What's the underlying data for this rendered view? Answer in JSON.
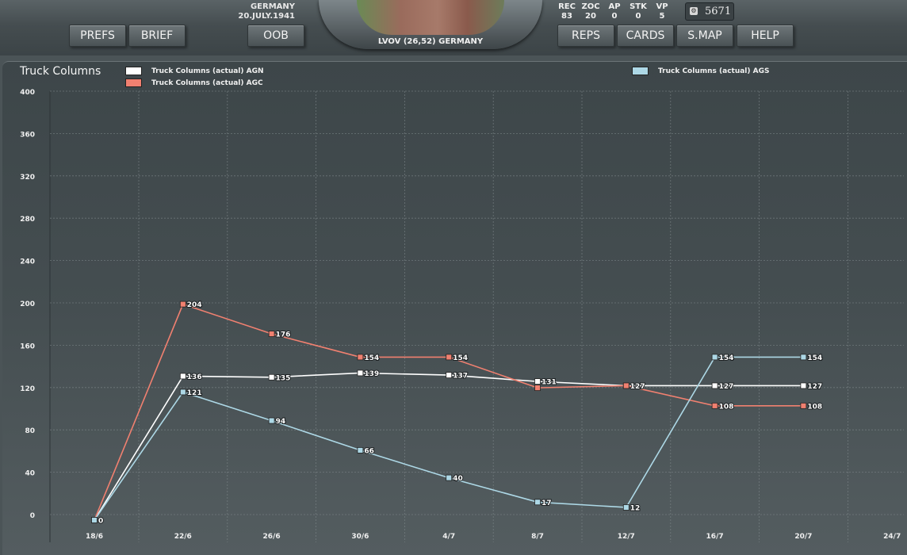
{
  "header": {
    "nation": "GERMANY",
    "date": "20.JULY.1941",
    "location": "LVOV (26,52) GERMANY",
    "prestige": "5671"
  },
  "buttons": {
    "prefs": "PREFS",
    "brief": "BRIEF",
    "oob": "OOB",
    "reps": "REPS",
    "cards": "CARDS",
    "smap": "S.MAP",
    "help": "HELP"
  },
  "stats": [
    {
      "label": "REC",
      "value": "83"
    },
    {
      "label": "ZOC",
      "value": "20"
    },
    {
      "label": "AP",
      "value": "0"
    },
    {
      "label": "STK",
      "value": "0"
    },
    {
      "label": "VP",
      "value": "5"
    }
  ],
  "colors": {
    "agn": "#ffffff",
    "agc": "#f08070",
    "ags": "#add8e6"
  },
  "chart_data": {
    "type": "line",
    "title": "Truck Columns",
    "categories": [
      "18/6",
      "22/6",
      "26/6",
      "30/6",
      "4/7",
      "8/7",
      "12/7",
      "16/7",
      "20/7",
      "24/7"
    ],
    "yticks": [
      0,
      40,
      80,
      120,
      160,
      200,
      240,
      280,
      320,
      360,
      400
    ],
    "ylim": [
      0,
      400
    ],
    "grid": true,
    "series": [
      {
        "name": "Truck Columns (actual) AGN",
        "color": "#ffffff",
        "values": [
          0,
          136,
          135,
          139,
          137,
          131,
          127,
          127,
          127
        ],
        "labels": [
          "0",
          "136",
          "135",
          "139",
          "137",
          "131",
          "127",
          "127",
          "127"
        ]
      },
      {
        "name": "Truck Columns (actual) AGC",
        "color": "#f08070",
        "values": [
          0,
          204,
          176,
          154,
          154,
          125,
          127,
          108,
          108
        ],
        "labels": [
          "",
          "204",
          "176",
          "154",
          "154",
          "",
          "",
          "108",
          "108"
        ]
      },
      {
        "name": "Truck Columns (actual) AGS",
        "color": "#add8e6",
        "values": [
          0,
          121,
          94,
          66,
          40,
          17,
          12,
          154,
          154
        ],
        "labels": [
          "",
          "121",
          "94",
          "66",
          "40",
          "17",
          "12",
          "154",
          "154"
        ]
      }
    ]
  }
}
